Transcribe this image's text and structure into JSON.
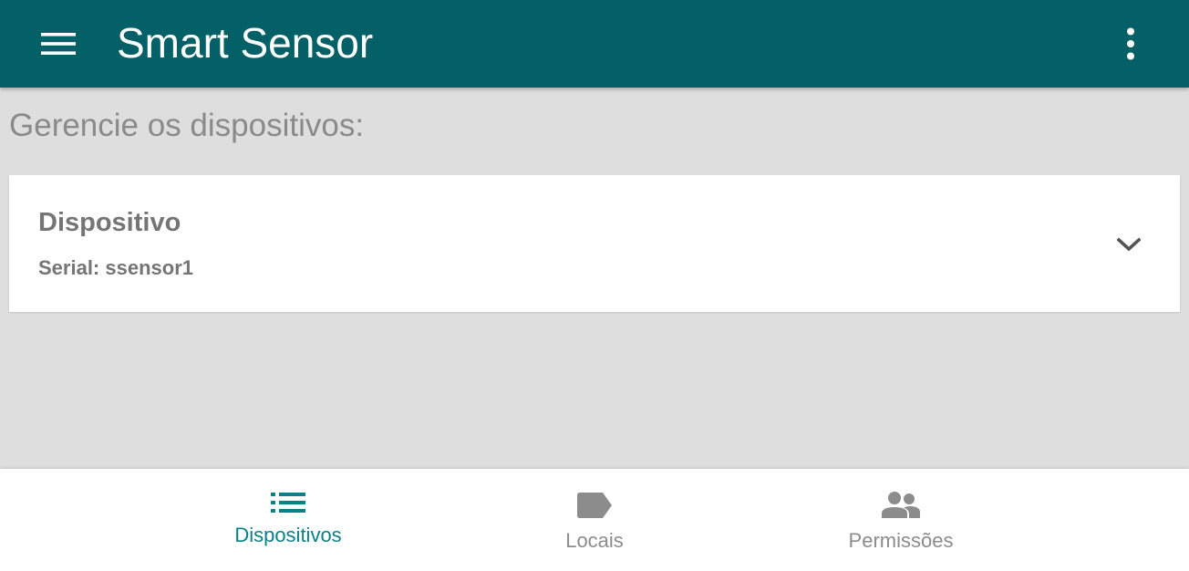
{
  "appbar": {
    "title": "Smart Sensor",
    "background_color": "#036066",
    "menu_icon": "hamburger-menu-icon",
    "overflow_icon": "more-vert-icon"
  },
  "main": {
    "section_title": "Gerencie os dispositivos:",
    "devices": [
      {
        "title": "Dispositivo",
        "serial": "Serial: ssensor1",
        "expand_icon": "chevron-down-icon"
      }
    ]
  },
  "bottom_nav": {
    "active_color": "#0a8088",
    "inactive_color": "#8c8c8c",
    "items": [
      {
        "label": "Dispositivos",
        "icon": "list-icon",
        "active": true
      },
      {
        "label": "Locais",
        "icon": "label-tag-icon",
        "active": false
      },
      {
        "label": "Permissões",
        "icon": "people-icon",
        "active": false
      }
    ]
  }
}
